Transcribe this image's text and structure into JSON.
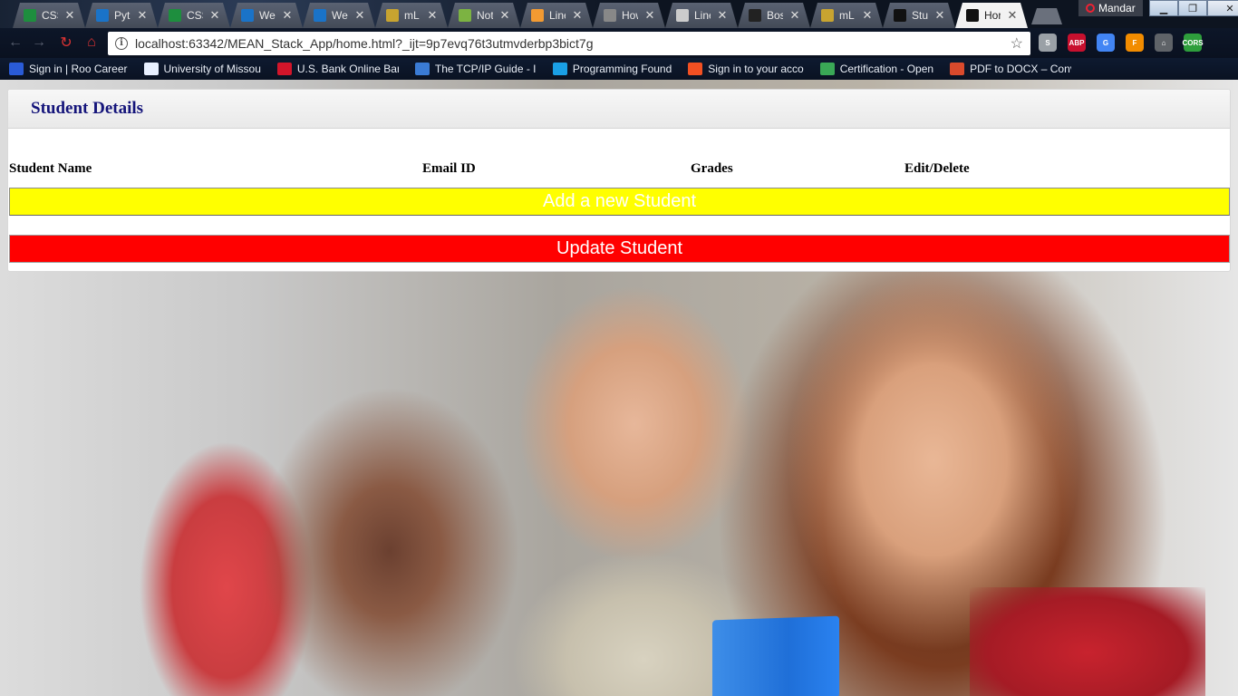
{
  "browser": {
    "tabs": [
      {
        "label": "CSS",
        "icon": "sheets-icon",
        "color": "#1e8e3e"
      },
      {
        "label": "Pyth",
        "icon": "box-icon",
        "color": "#1a73c8"
      },
      {
        "label": "CSS",
        "icon": "sheets-icon",
        "color": "#1e8e3e"
      },
      {
        "label": "We",
        "icon": "box-icon",
        "color": "#1a73c8"
      },
      {
        "label": "We",
        "icon": "box-icon",
        "color": "#1a73c8"
      },
      {
        "label": "mL",
        "icon": "mlab-icon",
        "color": "#c8a430"
      },
      {
        "label": "Not",
        "icon": "node-icon",
        "color": "#7cb342"
      },
      {
        "label": "Line",
        "icon": "linear-icon",
        "color": "#f29a32"
      },
      {
        "label": "How",
        "icon": "howto-icon",
        "color": "#888888"
      },
      {
        "label": "Line",
        "icon": "doc-icon",
        "color": "#cccccc"
      },
      {
        "label": "Bos",
        "icon": "github-icon",
        "color": "#222222"
      },
      {
        "label": "mL",
        "icon": "mlab-icon",
        "color": "#c8a430"
      },
      {
        "label": "Stu",
        "icon": "webstorm-icon",
        "color": "#111111"
      },
      {
        "label": "Hor",
        "icon": "webstorm-icon",
        "color": "#111111",
        "active": true
      }
    ],
    "close_glyph": "✕",
    "profile_name": "Mandar",
    "address": "localhost:63342/MEAN_Stack_App/home.html?_ijt=9p7evq76t3utmvderbp3bict7g",
    "extensions": [
      {
        "name": "skype-icon",
        "label": "S",
        "color": "#9aa0a6"
      },
      {
        "name": "adblock-icon",
        "label": "ABP",
        "color": "#c8102e"
      },
      {
        "name": "translate-icon",
        "label": "G",
        "color": "#4285f4"
      },
      {
        "name": "firebug-icon",
        "label": "F",
        "color": "#f28c00"
      },
      {
        "name": "home-icon",
        "label": "⌂",
        "color": "#5f6368"
      },
      {
        "name": "cors-icon",
        "label": "CORS",
        "color": "#2e9e3c"
      }
    ],
    "bookmarks": [
      {
        "label": "Sign in | Roo Career",
        "color": "#2a5bd7"
      },
      {
        "label": "University of Missou",
        "color": "#e8f0ff"
      },
      {
        "label": "U.S. Bank Online Ban",
        "color": "#d3152a"
      },
      {
        "label": "The TCP/IP Guide - In",
        "color": "#3a7bd5"
      },
      {
        "label": "Programming Found",
        "color": "#1aa0e6"
      },
      {
        "label": "Sign in to your acco",
        "color": "#f25022"
      },
      {
        "label": "Certification - Open",
        "color": "#3aa856"
      },
      {
        "label": "PDF to DOCX – Conv",
        "color": "#d94a2c"
      }
    ]
  },
  "panel": {
    "title": "Student Details",
    "columns": [
      "Student Name",
      "Email ID",
      "Grades",
      "Edit/Delete"
    ],
    "add_button": "Add a new Student",
    "update_button": "Update Student"
  },
  "colors": {
    "add_button_bg": "#ffff00",
    "update_button_bg": "#ff0000",
    "title_color": "#14147a"
  }
}
